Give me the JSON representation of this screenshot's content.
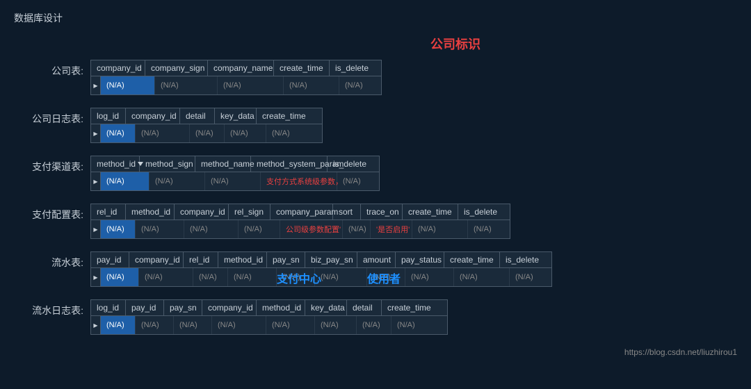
{
  "page": {
    "title": "数据库设计",
    "company_sign_label": "公司标识",
    "footer_url": "https://blog.csdn.net/liuzhirou1"
  },
  "tables": [
    {
      "label": "公司表:",
      "id": "company-table",
      "columns": [
        "company_id",
        "company_sign",
        "company_name",
        "create_time",
        "is_delete"
      ],
      "row": [
        "(N/A)",
        "(N/A)",
        "(N/A)",
        "(N/A)",
        "(N/A)"
      ],
      "highlighted_col": 0
    },
    {
      "label": "公司日志表:",
      "id": "company-log-table",
      "columns": [
        "log_id",
        "company_id",
        "detail",
        "key_data",
        "create_time"
      ],
      "row": [
        "(N/A)",
        "(N/A)",
        "(N/A)",
        "(N/A)",
        "(N/A)"
      ],
      "highlighted_col": 0
    },
    {
      "label": "支付渠道表:",
      "id": "payment-channel-table",
      "columns": [
        "method_id",
        "method_sign",
        "method_name",
        "method_system_param",
        "is_delete"
      ],
      "row": [
        "(N/A)",
        "(N/A)",
        "(N/A)",
        "支付方式系统级参数，",
        "(N/A)"
      ],
      "highlighted_col": 0,
      "sorted_col": 0
    },
    {
      "label": "支付配置表:",
      "id": "payment-config-table",
      "columns": [
        "rel_id",
        "method_id",
        "company_id",
        "rel_sign",
        "company_param",
        "sort",
        "trace_on",
        "create_time",
        "is_delete"
      ],
      "row": [
        "(N/A)",
        "(N/A)",
        "(N/A)",
        "(N/A)",
        "公司级参数配置'",
        "(N/A)",
        "'是否启用'",
        "(N/A)",
        "(N/A)"
      ],
      "highlighted_col": 0
    },
    {
      "label": "流水表:",
      "id": "flow-table",
      "columns": [
        "pay_id",
        "company_id",
        "rel_id",
        "method_id",
        "pay_sn",
        "biz_pay_sn",
        "amount",
        "pay_status",
        "create_time",
        "is_delete"
      ],
      "row": [
        "(N/A)",
        "(N/A)",
        "(N/A)",
        "(N/A)",
        "(N/A)",
        "(N/A)",
        "(N/A)",
        "(N/A)",
        "(N/A)",
        "(N/A)"
      ],
      "highlighted_col": 0,
      "overlay": {
        "pay_center": "支付中心",
        "user": "使用者"
      }
    },
    {
      "label": "流水日志表:",
      "id": "flow-log-table",
      "columns": [
        "log_id",
        "pay_id",
        "pay_sn",
        "company_id",
        "method_id",
        "key_data",
        "detail",
        "create_time"
      ],
      "row": [
        "(N/A)",
        "(N/A)",
        "(N/A)",
        "(N/A)",
        "(N/A)",
        "(N/A)",
        "(N/A)",
        "(N/A)"
      ],
      "highlighted_col": 0
    }
  ]
}
